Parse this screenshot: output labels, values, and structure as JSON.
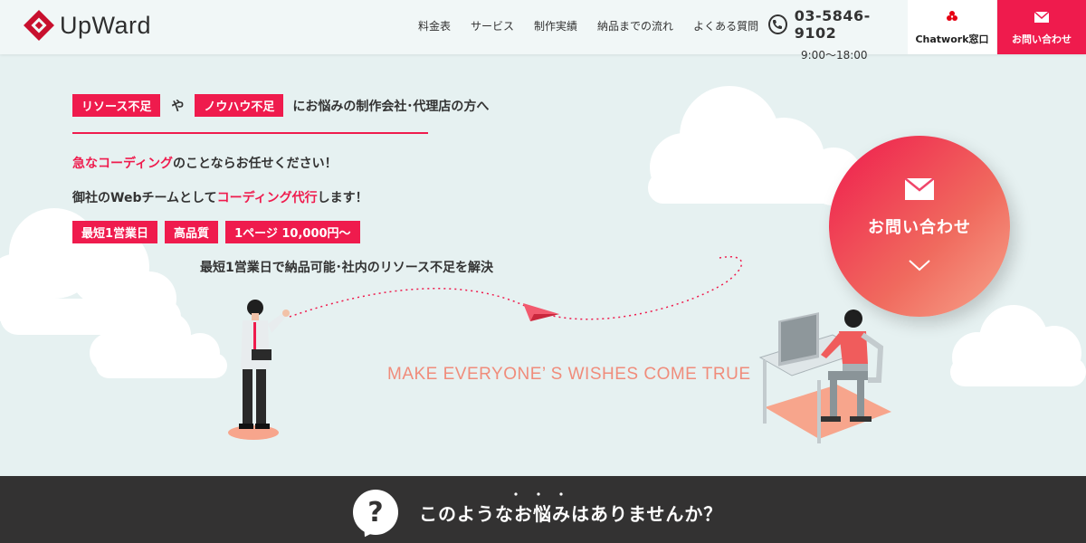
{
  "header": {
    "logo_text": "UpWard",
    "nav": [
      {
        "label": "料金表"
      },
      {
        "label": "サービス"
      },
      {
        "label": "制作実績"
      },
      {
        "label": "納品までの流れ"
      },
      {
        "label": "よくある質問"
      }
    ],
    "phone_number": "03-5846-9102",
    "phone_hours": "9:00～18:00",
    "chatwork_label": "Chatwork窓口",
    "contact_label": "お問い合わせ"
  },
  "hero": {
    "tag_resource": "リソース不足",
    "connector": "や",
    "tag_knowhow": "ノウハウ不足",
    "headline_rest": "にお悩みの制作会社･代理店の方へ",
    "line2_accent": "急なコーディング",
    "line2_rest": "のことならお任せください！",
    "line3_prefix": "御社のWebチームとして",
    "line3_accent": "コーディング代行",
    "line3_suffix": "します！",
    "badges": [
      {
        "label": "最短1営業日"
      },
      {
        "label": "高品質"
      },
      {
        "label": "1ページ 10,000円～"
      }
    ],
    "subline": "最短1営業日で納品可能･社内のリソース不足を解決",
    "tagline": "MAKE EVERYONE’ S  WISHES COME TRUE",
    "cta_label": "お問い合わせ"
  },
  "band": {
    "question_mark": "?",
    "title": "このようなお悩みはありませんか？"
  },
  "colors": {
    "accent": "#ef1b4d",
    "background": "#e6f1f1",
    "band": "#333232",
    "tagline": "#f08c7b"
  },
  "icons": [
    "logo-mark-icon",
    "phone-icon",
    "chatwork-icon",
    "mail-icon",
    "chevron-down-icon",
    "question-icon"
  ]
}
